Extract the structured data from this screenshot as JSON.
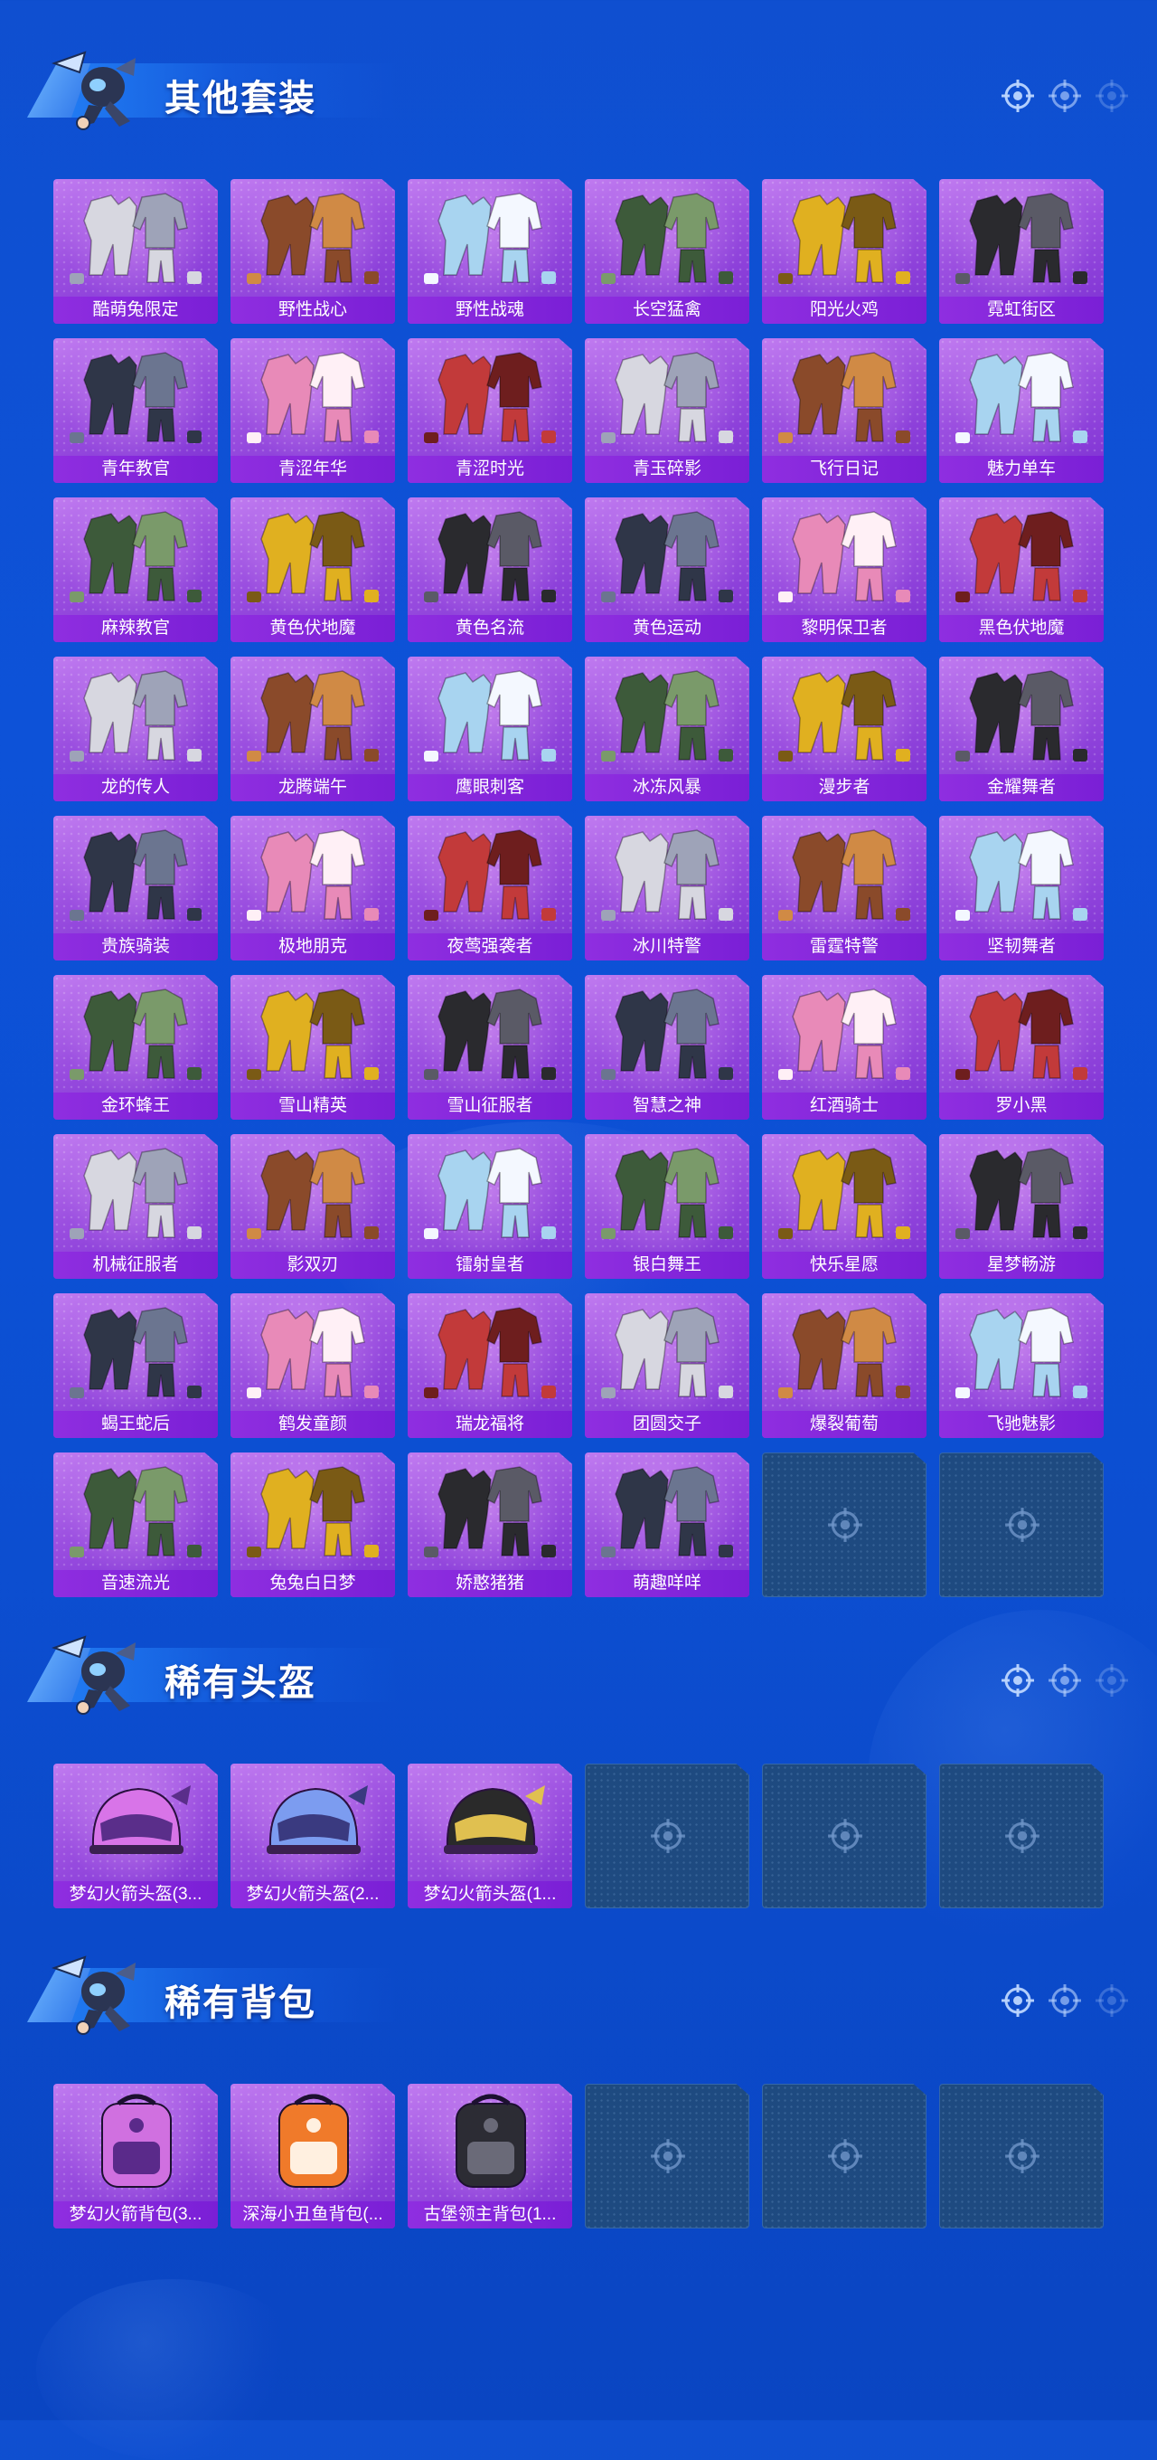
{
  "sections": [
    {
      "title": "其他套装",
      "items": [
        "酷萌兔限定",
        "野性战心",
        "野性战魂",
        "长空猛禽",
        "阳光火鸡",
        "霓虹街区",
        "青年教官",
        "青涩年华",
        "青涩时光",
        "青玉碎影",
        "飞行日记",
        "魅力单车",
        "麻辣教官",
        "黄色伏地魔",
        "黄色名流",
        "黄色运动",
        "黎明保卫者",
        "黑色伏地魔",
        "龙的传人",
        "龙腾端午",
        "鹰眼刺客",
        "冰冻风暴",
        "漫步者",
        "金耀舞者",
        "贵族骑装",
        "极地朋克",
        "夜莺强袭者",
        "冰川特警",
        "雷霆特警",
        "坚韧舞者",
        "金环蜂王",
        "雪山精英",
        "雪山征服者",
        "智慧之神",
        "红酒骑士",
        "罗小黑",
        "机械征服者",
        "影双刃",
        "镭射皇者",
        "银白舞王",
        "快乐星愿",
        "星梦畅游",
        "蝎王蛇后",
        "鹤发童颜",
        "瑞龙福将",
        "团圆交子",
        "爆裂葡萄",
        "飞驰魅影",
        "音速流光",
        "兔兔白日梦",
        "娇憨猪猪",
        "萌趣咩咩"
      ],
      "empty_slots": 2
    },
    {
      "title": "稀有头盔",
      "items": [
        "梦幻火箭头盔(3...",
        "梦幻火箭头盔(2...",
        "梦幻火箭头盔(1..."
      ],
      "empty_slots": 3
    },
    {
      "title": "稀有背包",
      "items": [
        "梦幻火箭背包(3...",
        "深海小丑鱼背包(...",
        "古堡领主背包(1..."
      ],
      "empty_slots": 3
    }
  ],
  "colors": {
    "background": "#0d52d8",
    "card_fill": "#9b4fe0",
    "card_label": "#7a1fd6",
    "empty_card": "#1e4a80"
  },
  "icons": {
    "header_mascot": "parachute-mascot-icon",
    "header_target": "crosshair-icon",
    "empty_slot": "crosshair-icon"
  }
}
